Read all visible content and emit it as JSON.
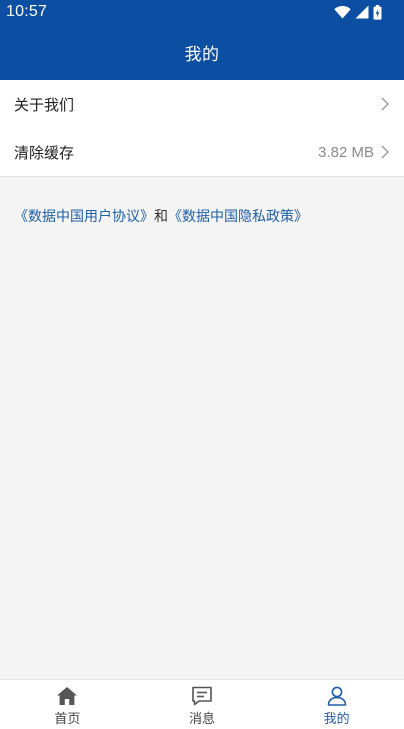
{
  "status_bar": {
    "time": "10:57",
    "icons": [
      "wifi-icon",
      "signal-icon",
      "battery-charging-icon"
    ]
  },
  "app_bar": {
    "title": "我的"
  },
  "menu": {
    "items": [
      {
        "label": "关于我们",
        "value": "",
        "icon": "chevron-right-icon"
      },
      {
        "label": "清除缓存",
        "value": "3.82 MB",
        "icon": "chevron-right-icon"
      }
    ]
  },
  "policy": {
    "user_agreement": "《数据中国用户协议》",
    "connector": "和",
    "privacy_policy": "《数据中国隐私政策》"
  },
  "tabs": [
    {
      "label": "首页",
      "icon": "home-icon",
      "active": false
    },
    {
      "label": "消息",
      "icon": "message-icon",
      "active": false
    },
    {
      "label": "我的",
      "icon": "person-icon",
      "active": true
    }
  ],
  "colors": {
    "primary": "#0b4ea2",
    "link": "#1f5fa8",
    "background": "#f4f4f4"
  }
}
